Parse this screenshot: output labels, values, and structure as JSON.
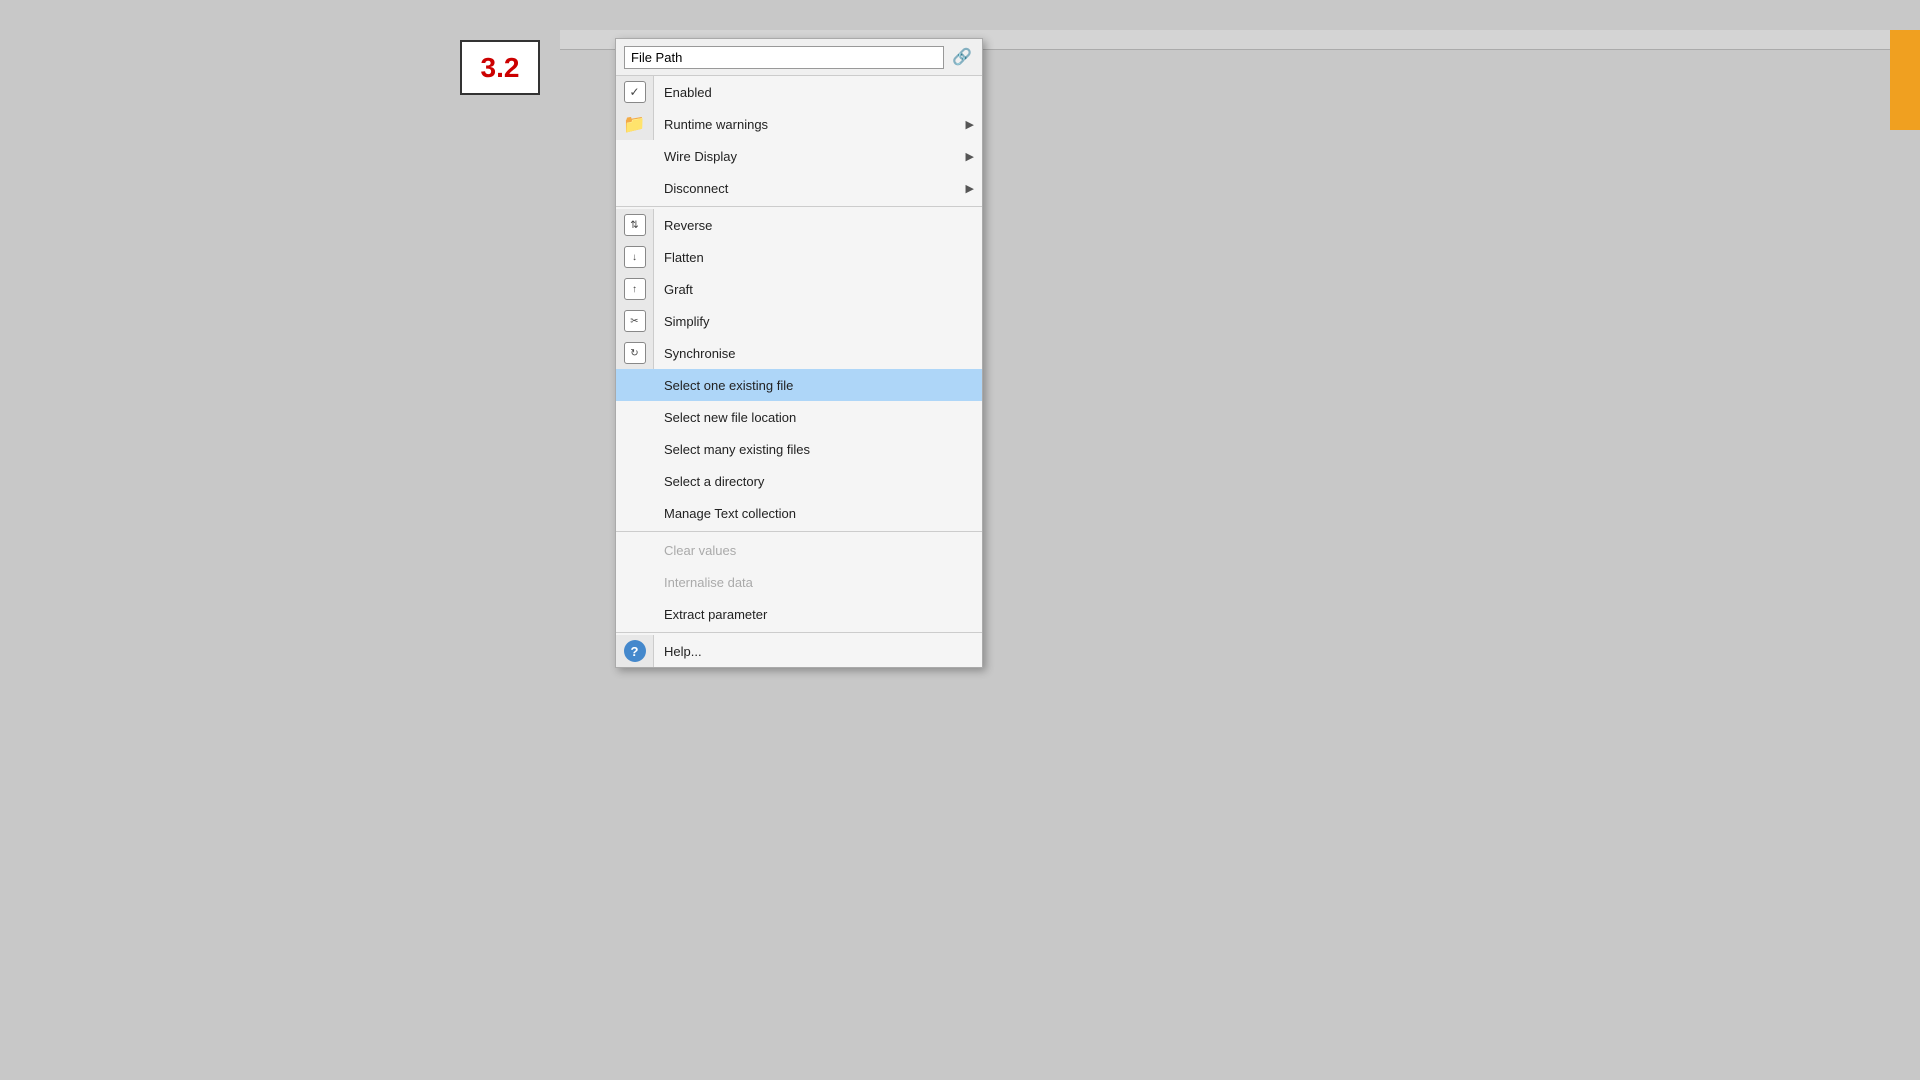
{
  "version": {
    "label": "3.2"
  },
  "menu": {
    "header": {
      "title": "File Path",
      "icon": "🔗"
    },
    "items": [
      {
        "id": "enabled",
        "label": "Enabled",
        "icon": "checkbox",
        "hasArrow": false,
        "disabled": false,
        "highlighted": false,
        "separator_after": false
      },
      {
        "id": "runtime-warnings",
        "label": "Runtime warnings",
        "icon": "folder",
        "hasArrow": true,
        "disabled": false,
        "highlighted": false,
        "separator_after": false
      },
      {
        "id": "wire-display",
        "label": "Wire Display",
        "icon": null,
        "hasArrow": true,
        "disabled": false,
        "highlighted": false,
        "separator_after": false
      },
      {
        "id": "disconnect",
        "label": "Disconnect",
        "icon": null,
        "hasArrow": true,
        "disabled": false,
        "highlighted": false,
        "separator_after": true
      },
      {
        "id": "reverse",
        "label": "Reverse",
        "icon": "reverse",
        "hasArrow": false,
        "disabled": false,
        "highlighted": false,
        "separator_after": false
      },
      {
        "id": "flatten",
        "label": "Flatten",
        "icon": "flatten",
        "hasArrow": false,
        "disabled": false,
        "highlighted": false,
        "separator_after": false
      },
      {
        "id": "graft",
        "label": "Graft",
        "icon": "graft",
        "hasArrow": false,
        "disabled": false,
        "highlighted": false,
        "separator_after": false
      },
      {
        "id": "simplify",
        "label": "Simplify",
        "icon": "simplify",
        "hasArrow": false,
        "disabled": false,
        "highlighted": false,
        "separator_after": false
      },
      {
        "id": "synchronise",
        "label": "Synchronise",
        "icon": "synchronise",
        "hasArrow": false,
        "disabled": false,
        "highlighted": false,
        "separator_after": false
      },
      {
        "id": "select-one",
        "label": "Select one existing file",
        "icon": null,
        "hasArrow": false,
        "disabled": false,
        "highlighted": true,
        "separator_after": false
      },
      {
        "id": "select-new",
        "label": "Select new file location",
        "icon": null,
        "hasArrow": false,
        "disabled": false,
        "highlighted": false,
        "separator_after": false
      },
      {
        "id": "select-many",
        "label": "Select many existing files",
        "icon": null,
        "hasArrow": false,
        "disabled": false,
        "highlighted": false,
        "separator_after": false
      },
      {
        "id": "select-dir",
        "label": "Select a directory",
        "icon": null,
        "hasArrow": false,
        "disabled": false,
        "highlighted": false,
        "separator_after": false
      },
      {
        "id": "manage-text",
        "label": "Manage Text collection",
        "icon": null,
        "hasArrow": false,
        "disabled": false,
        "highlighted": false,
        "separator_after": true
      },
      {
        "id": "clear-values",
        "label": "Clear values",
        "icon": null,
        "hasArrow": false,
        "disabled": true,
        "highlighted": false,
        "separator_after": false
      },
      {
        "id": "internalise",
        "label": "Internalise data",
        "icon": null,
        "hasArrow": false,
        "disabled": true,
        "highlighted": false,
        "separator_after": false
      },
      {
        "id": "extract",
        "label": "Extract parameter",
        "icon": null,
        "hasArrow": false,
        "disabled": false,
        "highlighted": false,
        "separator_after": true
      },
      {
        "id": "help",
        "label": "Help...",
        "icon": "help",
        "hasArrow": false,
        "disabled": false,
        "highlighted": false,
        "separator_after": false
      }
    ]
  }
}
